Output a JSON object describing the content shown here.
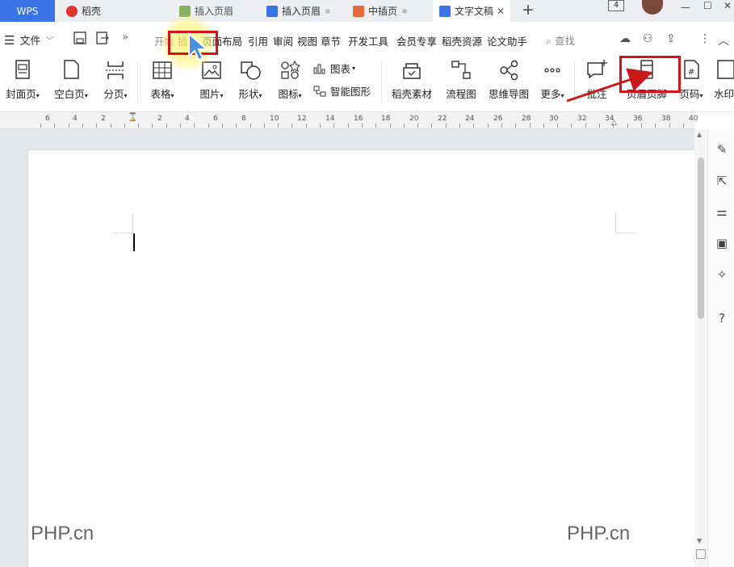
{
  "titlebar": {
    "wps_label": "WPS",
    "tabs": [
      {
        "label": "稻壳"
      },
      {
        "label": "插入页眉"
      },
      {
        "label": "插入页眉"
      },
      {
        "label": "中插页"
      },
      {
        "label": "文字文稿"
      }
    ],
    "window_count": "4",
    "add_icon": "plus-icon"
  },
  "menubar": {
    "file_label": "文件",
    "items": [
      "开始",
      "插入",
      "页面布局",
      "引用",
      "审阅",
      "视图",
      "章节",
      "开发工具",
      "会员专享",
      "稻壳资源",
      "论文助手"
    ],
    "search_label": "查找"
  },
  "ribbon": {
    "items": [
      {
        "label": "封面页",
        "dropdown": true,
        "icon": "cover-page-icon"
      },
      {
        "label": "空白页",
        "dropdown": true,
        "icon": "blank-page-icon"
      },
      {
        "label": "分页",
        "dropdown": true,
        "icon": "page-break-icon"
      },
      {
        "label": "表格",
        "dropdown": true,
        "icon": "table-icon"
      },
      {
        "label": "图片",
        "dropdown": true,
        "icon": "image-icon"
      },
      {
        "label": "形状",
        "dropdown": true,
        "icon": "shape-icon"
      },
      {
        "label": "图标",
        "dropdown": true,
        "icon": "icons-icon"
      },
      {
        "label": "图表",
        "dropdown": true,
        "icon": "chart-icon"
      },
      {
        "label": "智能图形",
        "dropdown": false,
        "icon": "smart-graphic-icon"
      },
      {
        "label": "稻壳素材",
        "dropdown": false,
        "icon": "docer-material-icon"
      },
      {
        "label": "流程图",
        "dropdown": false,
        "icon": "flowchart-icon"
      },
      {
        "label": "思维导图",
        "dropdown": false,
        "icon": "mindmap-icon"
      },
      {
        "label": "更多",
        "dropdown": true,
        "icon": "more-icon"
      },
      {
        "label": "批注",
        "dropdown": false,
        "icon": "comment-icon"
      },
      {
        "label": "页眉页脚",
        "dropdown": false,
        "icon": "header-footer-icon"
      },
      {
        "label": "页码",
        "dropdown": true,
        "icon": "page-number-icon"
      },
      {
        "label": "水印",
        "dropdown": false,
        "icon": "watermark-icon"
      }
    ]
  },
  "ruler": {
    "ticks": [
      "6",
      "4",
      "2",
      "2",
      "4",
      "6",
      "8",
      "10",
      "12",
      "14",
      "16",
      "18",
      "20",
      "22",
      "24",
      "26",
      "28",
      "30",
      "32",
      "34",
      "36",
      "38",
      "40"
    ]
  },
  "document": {
    "watermark_left": "PHP.cn",
    "watermark_right": "PHP.cn"
  },
  "colors": {
    "accent": "#3a73e8",
    "highlight_red": "#d3131b",
    "spotlight": "#fff378"
  }
}
